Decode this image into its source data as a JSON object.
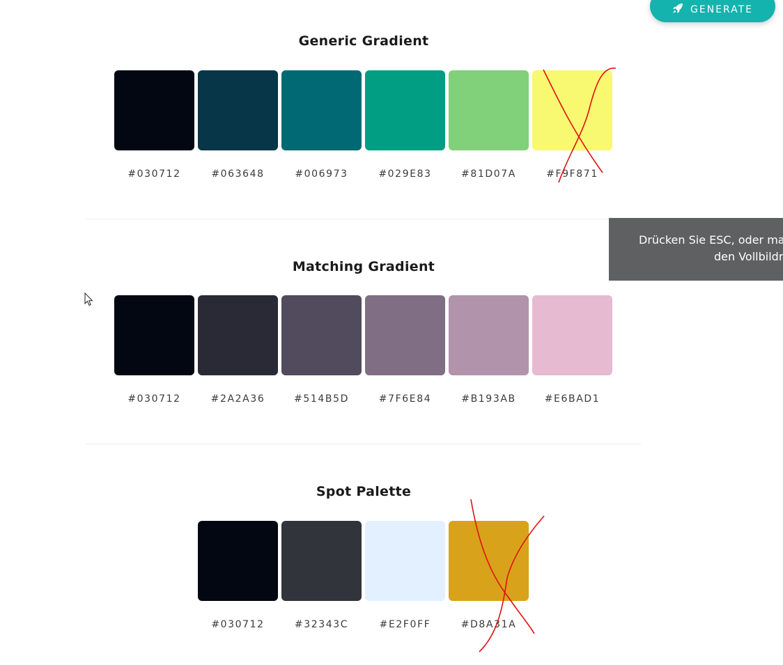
{
  "generate_button": {
    "label": "GENERATE",
    "icon": "rocket-icon",
    "color": "#14b3ae"
  },
  "sections": [
    {
      "title": "Generic Gradient",
      "swatches": [
        {
          "hex": "#030712",
          "color": "#030712"
        },
        {
          "hex": "#063648",
          "color": "#063648"
        },
        {
          "hex": "#006973",
          "color": "#006973"
        },
        {
          "hex": "#029E83",
          "color": "#029E83"
        },
        {
          "hex": "#81D07A",
          "color": "#81D07A"
        },
        {
          "hex": "#F9F871",
          "color": "#F9F871"
        }
      ]
    },
    {
      "title": "Matching Gradient",
      "swatches": [
        {
          "hex": "#030712",
          "color": "#030712"
        },
        {
          "hex": "#2A2A36",
          "color": "#2A2A36"
        },
        {
          "hex": "#514B5D",
          "color": "#514B5D"
        },
        {
          "hex": "#7F6E84",
          "color": "#7F6E84"
        },
        {
          "hex": "#B193AB",
          "color": "#B193AB"
        },
        {
          "hex": "#E6BAD1",
          "color": "#E6BAD1"
        }
      ]
    },
    {
      "title": "Spot Palette",
      "swatches": [
        {
          "hex": "#030712",
          "color": "#030712"
        },
        {
          "hex": "#32343C",
          "color": "#32343C"
        },
        {
          "hex": "#E2F0FF",
          "color": "#E2F0FF"
        },
        {
          "hex": "#D8A31A",
          "color": "#D8A31A"
        }
      ]
    }
  ],
  "fullscreen_notice": {
    "line1": "Drücken Sie ESC, oder mac",
    "line2": "den Vollbildr"
  },
  "annotation_color": "#e01010"
}
